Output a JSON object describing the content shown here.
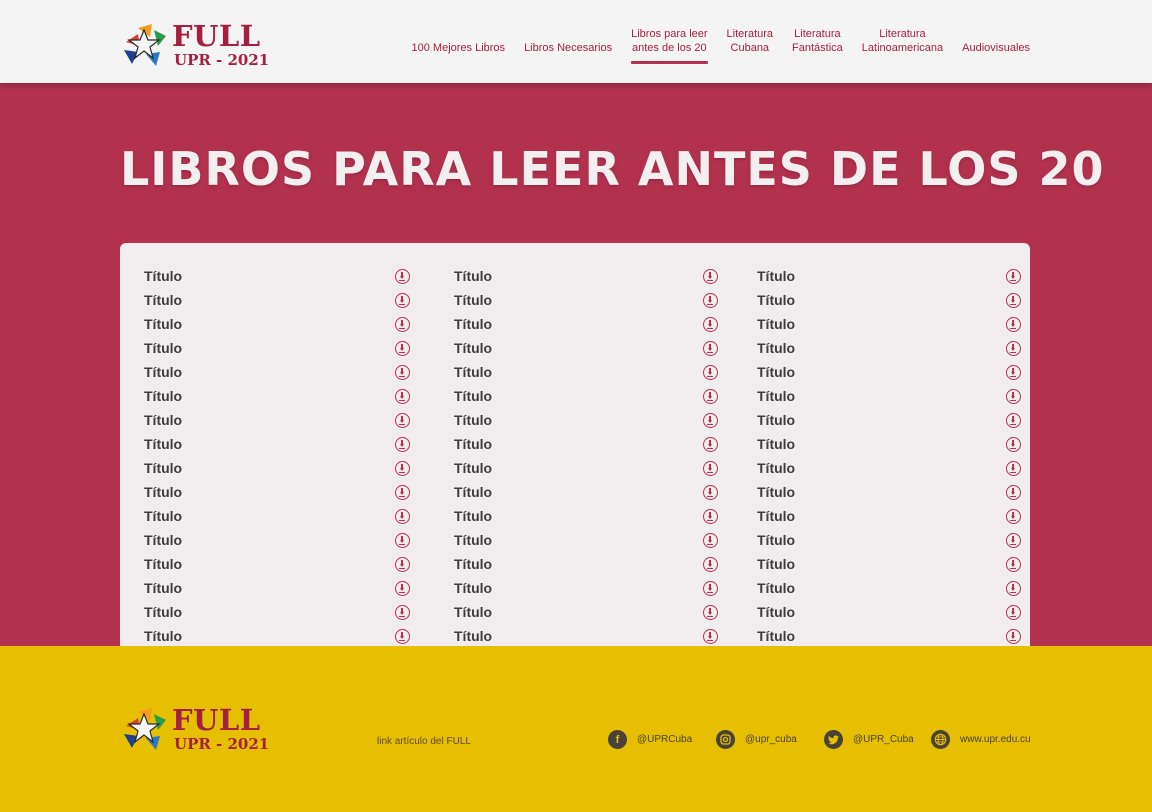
{
  "brand": {
    "name": "FULL",
    "subtitle": "UPR - 2021"
  },
  "nav": {
    "items": [
      {
        "label": "100 Mejores Libros"
      },
      {
        "label": "Libros Necesarios"
      },
      {
        "line1": "Libros para leer",
        "line2": "antes de los 20",
        "active": true
      },
      {
        "line1": "Literatura",
        "line2": "Cubana"
      },
      {
        "line1": "Literatura",
        "line2": "Fantástica"
      },
      {
        "line1": "Literatura",
        "line2": "Latinoamericana"
      },
      {
        "label": "Audiovisuales"
      }
    ]
  },
  "page": {
    "title": "LIBROS PARA LEER ANTES DE LOS 20"
  },
  "list": {
    "columns": [
      [
        "Título",
        "Título",
        "Título",
        "Título",
        "Título",
        "Título",
        "Título",
        "Título",
        "Título",
        "Título",
        "Título",
        "Título",
        "Título",
        "Título",
        "Título",
        "Título"
      ],
      [
        "Título",
        "Título",
        "Título",
        "Título",
        "Título",
        "Título",
        "Título",
        "Título",
        "Título",
        "Título",
        "Título",
        "Título",
        "Título",
        "Título",
        "Título",
        "Título"
      ],
      [
        "Título",
        "Título",
        "Título",
        "Título",
        "Título",
        "Título",
        "Título",
        "Título",
        "Título",
        "Título",
        "Título",
        "Título",
        "Título",
        "Título",
        "Título",
        "Título"
      ]
    ],
    "icon": "download-icon"
  },
  "footer": {
    "link_label": "link artículo del FULL",
    "social": [
      {
        "icon": "facebook-icon",
        "label": "@UPRCuba"
      },
      {
        "icon": "instagram-icon",
        "label": "@upr_cuba"
      },
      {
        "icon": "twitter-icon",
        "label": "@UPR_Cuba"
      },
      {
        "icon": "globe-icon",
        "label": "www.upr.edu.cu"
      }
    ]
  },
  "colors": {
    "primary": "#b2314f",
    "accent": "#a51f3f",
    "footer": "#e6c000",
    "card": "#f1ecee",
    "header": "#f5f4f4"
  }
}
